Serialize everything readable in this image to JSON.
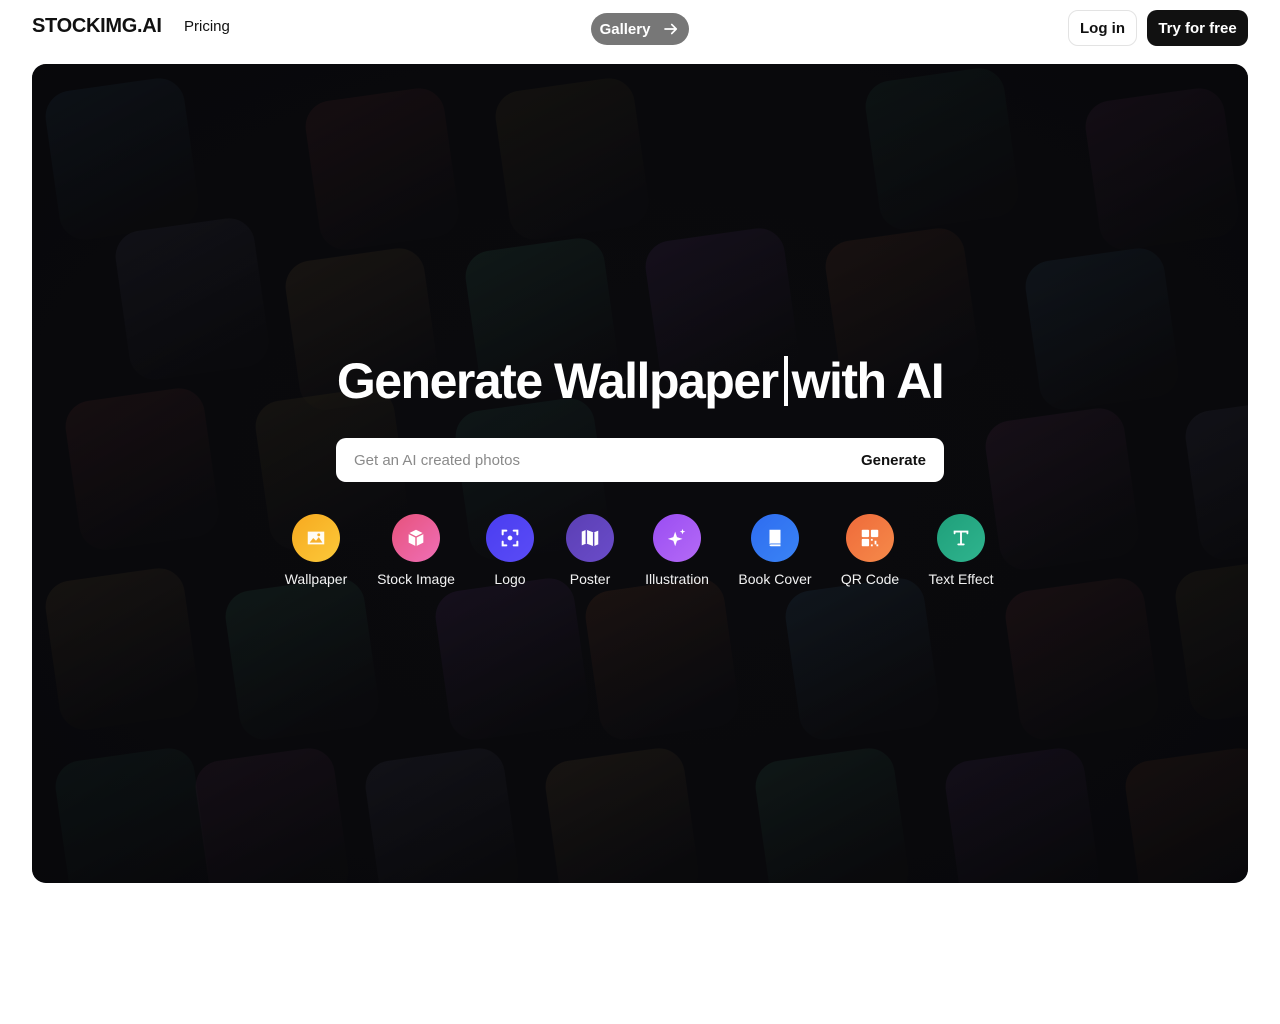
{
  "nav": {
    "logo": "STOCKIMG.AI",
    "pricing": "Pricing",
    "gallery": "Gallery",
    "login": "Log in",
    "try_free": "Try for free"
  },
  "hero": {
    "headline_part1": "Generate Wallpaper",
    "headline_part2": "with AI",
    "search_placeholder": "Get an AI created photos",
    "search_value": "",
    "generate_label": "Generate",
    "categories": [
      {
        "label": "Wallpaper",
        "icon": "image-icon",
        "gradient": [
          "#f7a91f",
          "#fbc93a"
        ]
      },
      {
        "label": "Stock Image",
        "icon": "package-icon",
        "gradient": [
          "#e7527c",
          "#ef6fb6"
        ]
      },
      {
        "label": "Logo",
        "icon": "focus-icon",
        "gradient": [
          "#4a3df0",
          "#5a4cf6"
        ]
      },
      {
        "label": "Poster",
        "icon": "map-icon",
        "gradient": [
          "#5b3fb4",
          "#6a4cc9"
        ]
      },
      {
        "label": "Illustration",
        "icon": "sparkle-icon",
        "gradient": [
          "#9a4df2",
          "#b46af6"
        ]
      },
      {
        "label": "Book Cover",
        "icon": "book-icon",
        "gradient": [
          "#2e6cf0",
          "#3a84f5"
        ]
      },
      {
        "label": "QR Code",
        "icon": "qr-code-icon",
        "gradient": [
          "#ef6a3a",
          "#f58a4a"
        ]
      },
      {
        "label": "Text Effect",
        "icon": "text-icon",
        "gradient": [
          "#1f9f7a",
          "#2fb48e"
        ]
      }
    ]
  }
}
